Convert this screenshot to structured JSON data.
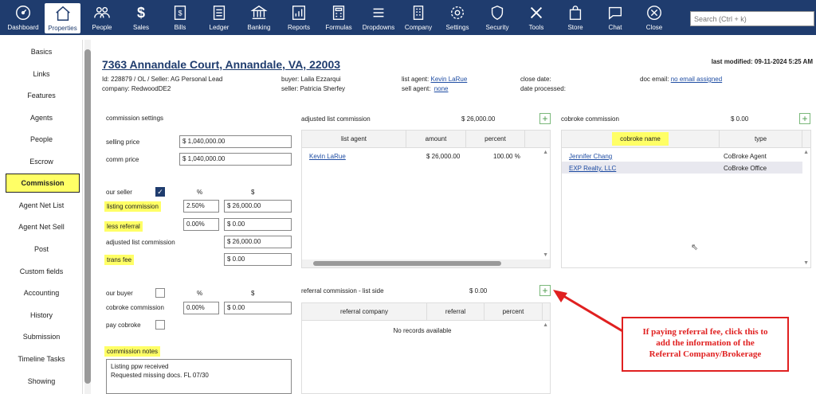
{
  "nav": [
    {
      "label": "Dashboard",
      "icon": "dashboard-gauge-icon"
    },
    {
      "label": "Properties",
      "icon": "house-icon"
    },
    {
      "label": "People",
      "icon": "people-icon"
    },
    {
      "label": "Sales",
      "icon": "dollar-icon"
    },
    {
      "label": "Bills",
      "icon": "bill-icon"
    },
    {
      "label": "Ledger",
      "icon": "ledger-icon"
    },
    {
      "label": "Banking",
      "icon": "bank-icon"
    },
    {
      "label": "Reports",
      "icon": "report-chart-icon"
    },
    {
      "label": "Formulas",
      "icon": "calculator-icon"
    },
    {
      "label": "Dropdowns",
      "icon": "list-icon"
    },
    {
      "label": "Company",
      "icon": "building-icon"
    },
    {
      "label": "Settings",
      "icon": "gear-icon"
    },
    {
      "label": "Security",
      "icon": "shield-icon"
    },
    {
      "label": "Tools",
      "icon": "tools-icon"
    },
    {
      "label": "Store",
      "icon": "shopping-bag-icon"
    },
    {
      "label": "Chat",
      "icon": "chat-bubble-icon"
    },
    {
      "label": "Close",
      "icon": "close-circle-icon"
    }
  ],
  "search_placeholder": "Search (Ctrl + k)",
  "sidebar": [
    "Basics",
    "Links",
    "Features",
    "Agents",
    "People",
    "Escrow",
    "Commission",
    "Agent Net List",
    "Agent Net Sell",
    "Post",
    "Custom fields",
    "Accounting",
    "History",
    "Submission",
    "Timeline Tasks",
    "Showing"
  ],
  "sidebar_active": "Commission",
  "header": {
    "address": "7363 Annandale Court, Annandale, VA, 22003",
    "last_modified": "last modified: 09-11-2024 5:25 AM",
    "id_line": "Id: 228879 / OL / Seller: AG Personal Lead",
    "company": "company: RedwoodDE2",
    "buyer": "buyer: Laila Ezzarqui",
    "seller": "seller: Patricia Sherfey",
    "list_agent_label": "list agent:",
    "list_agent": "Kevin LaRue",
    "sell_agent_label": "sell agent:",
    "sell_agent": "none",
    "close_date": "close date:",
    "date_processed": "date processed:",
    "doc_email_label": "doc email:",
    "doc_email": "no email assigned"
  },
  "commission": {
    "settings_title": "commission settings",
    "selling_price_label": "selling price",
    "selling_price": "$ 1,040,000.00",
    "comm_price_label": "comm price",
    "comm_price": "$ 1,040,000.00",
    "our_seller": "our seller",
    "pct_header": "%",
    "dollar_header": "$",
    "listing_commission": "listing commission",
    "listing_pct": "2.50%",
    "listing_amt": "$ 26,000.00",
    "less_referral": "less referral",
    "referral_pct": "0.00%",
    "referral_amt": "$ 0.00",
    "adjusted_label": "adjusted list commission",
    "adjusted_amt": "$ 26,000.00",
    "trans_fee": "trans fee",
    "trans_fee_amt": "$ 0.00",
    "our_buyer": "our buyer",
    "cobroke_commission": "cobroke commission",
    "cobroke_pct": "0.00%",
    "cobroke_amt": "$ 0.00",
    "pay_cobroke": "pay cobroke",
    "notes_title": "commission notes",
    "notes_line1": "Listing ppw received",
    "notes_line2": "Requested missing docs. FL 07/30"
  },
  "adj_list": {
    "title": "adjusted list commission",
    "total": "$ 26,000.00",
    "headers": [
      "list agent",
      "amount",
      "percent"
    ],
    "row": {
      "agent": "Kevin LaRue",
      "amount": "$ 26,000.00",
      "percent": "100.00 %"
    }
  },
  "cobroke": {
    "title": "cobroke commission",
    "total": "$ 0.00",
    "headers": [
      "cobroke name",
      "type"
    ],
    "rows": [
      {
        "name": "Jennifer Chang",
        "type": "CoBroke Agent"
      },
      {
        "name": "EXP Realty, LLC",
        "type": "CoBroke Office"
      }
    ]
  },
  "referral": {
    "title": "referral commission - list side",
    "total": "$ 0.00",
    "headers": [
      "referral company",
      "referral",
      "percent"
    ],
    "empty": "No records available"
  },
  "callout": {
    "line1": "If paying referral fee, click this to",
    "line2": "add the information of the",
    "line3": "Referral Company/Brokerage"
  },
  "colors": {
    "nav_bg": "#1f3c6e",
    "highlight": "#ffff66",
    "callout": "#e02020",
    "link": "#1f4da3"
  }
}
